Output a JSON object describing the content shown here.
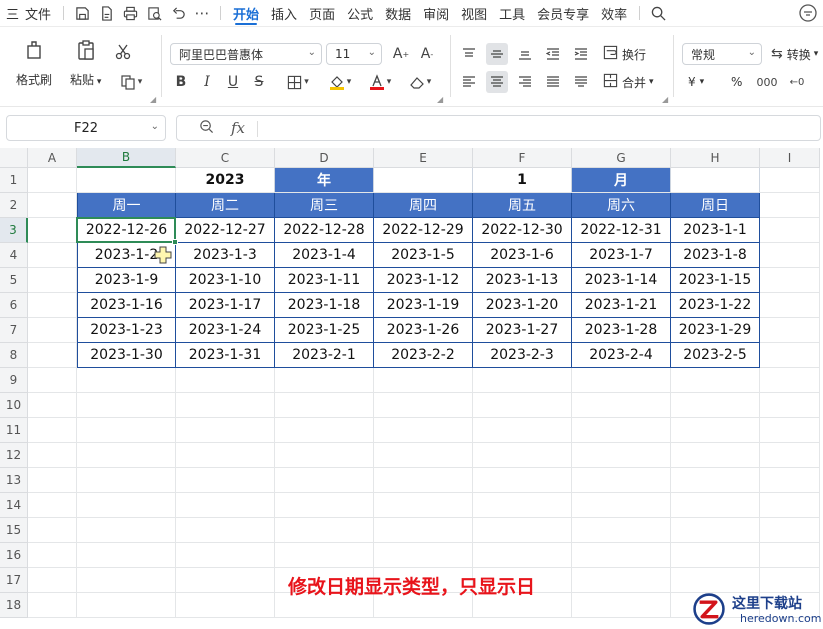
{
  "menu": {
    "hamburger": "三",
    "file": "文件",
    "tabs": [
      "开始",
      "插入",
      "页面",
      "公式",
      "数据",
      "审阅",
      "视图",
      "工具",
      "会员专享",
      "效率"
    ],
    "active_tab": "开始"
  },
  "ribbon": {
    "format_painter": "格式刷",
    "paste": "粘贴",
    "font_name": "阿里巴巴普惠体",
    "font_size": "11",
    "wrap": "换行",
    "merge": "合并",
    "number_format": "常规",
    "convert": "转换",
    "currency": "¥",
    "percent": "%"
  },
  "formula_bar": {
    "name_box": "F22",
    "fx_label": "fx",
    "formula": ""
  },
  "grid": {
    "columns": [
      "A",
      "B",
      "C",
      "D",
      "E",
      "F",
      "G",
      "H",
      "I"
    ],
    "rows": [
      "1",
      "2",
      "3",
      "4",
      "5",
      "6",
      "7",
      "8",
      "9",
      "10",
      "11",
      "12",
      "13",
      "14",
      "15",
      "16",
      "17",
      "18"
    ],
    "selected_column": "B",
    "selected_row": "3",
    "row1": {
      "C": "2023",
      "D": "年",
      "F": "1",
      "G": "月"
    },
    "weekdays": [
      "周一",
      "周二",
      "周三",
      "周四",
      "周五",
      "周六",
      "周日"
    ],
    "dates": [
      [
        "2022-12-26",
        "2022-12-27",
        "2022-12-28",
        "2022-12-29",
        "2022-12-30",
        "2022-12-31",
        "2023-1-1"
      ],
      [
        "2023-1-2",
        "2023-1-3",
        "2023-1-4",
        "2023-1-5",
        "2023-1-6",
        "2023-1-7",
        "2023-1-8"
      ],
      [
        "2023-1-9",
        "2023-1-10",
        "2023-1-11",
        "2023-1-12",
        "2023-1-13",
        "2023-1-14",
        "2023-1-15"
      ],
      [
        "2023-1-16",
        "2023-1-17",
        "2023-1-18",
        "2023-1-19",
        "2023-1-20",
        "2023-1-21",
        "2023-1-22"
      ],
      [
        "2023-1-23",
        "2023-1-24",
        "2023-1-25",
        "2023-1-26",
        "2023-1-27",
        "2023-1-28",
        "2023-1-29"
      ],
      [
        "2023-1-30",
        "2023-1-31",
        "2023-2-1",
        "2023-2-2",
        "2023-2-3",
        "2023-2-4",
        "2023-2-5"
      ]
    ]
  },
  "caption": "修改日期显示类型，只显示日",
  "watermark": {
    "title": "这里下载站",
    "url": "heredown.com"
  },
  "colors": {
    "accent": "#1a6fd6",
    "header_fill": "#4472c4",
    "table_border": "#1f4e9c",
    "selection": "#2e8b57",
    "caption": "#e8141b"
  }
}
